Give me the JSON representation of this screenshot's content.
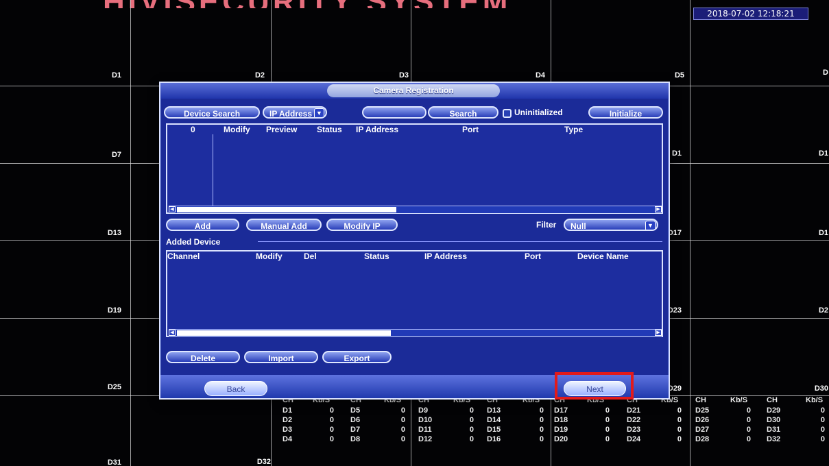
{
  "watermark": "HIVISECURITY SYSTEM",
  "timestamp": "2018-07-02 12:18:21",
  "grid_labels": [
    "D1",
    "D2",
    "D3",
    "D4",
    "D5",
    "D",
    "D7",
    "D1",
    "D13",
    "D1",
    "D17",
    "D1",
    "D19",
    "D2",
    "D23",
    "D25",
    "D29",
    "D30",
    "D31",
    "D32"
  ],
  "dialog": {
    "title": "Camera Registration",
    "top_buttons": {
      "device_search": "Device Search",
      "ip_address_select": "IP Address",
      "search": "Search",
      "uninitialized_label": "Uninitialized",
      "initialize": "Initialize"
    },
    "search_results": {
      "headers": [
        "0",
        "Modify",
        "Preview",
        "Status",
        "IP Address",
        "Port",
        "Type"
      ]
    },
    "actions": {
      "add": "Add",
      "manual_add": "Manual Add",
      "modify_ip": "Modify IP",
      "filter_label": "Filter",
      "filter_value": "Null"
    },
    "added_device": {
      "label": "Added Device",
      "headers": [
        "Channel",
        "Modify",
        "Del",
        "Status",
        "IP Address",
        "Port",
        "Device Name"
      ]
    },
    "bottom_actions": {
      "delete": "Delete",
      "import": "Import",
      "export": "Export"
    },
    "footer": {
      "back": "Back",
      "next": "Next"
    }
  },
  "bitrate": {
    "headers": [
      "CH",
      "Kb/S",
      "CH",
      "Kb/S",
      "CH",
      "Kb/S",
      "CH",
      "Kb/S",
      "CH",
      "Kb/S",
      "CH",
      "Kb/S",
      "CH",
      "Kb/S",
      "CH",
      "Kb/S"
    ],
    "rows": [
      [
        "D1",
        "0",
        "D5",
        "0",
        "D9",
        "0",
        "D13",
        "0",
        "D17",
        "0",
        "D21",
        "0",
        "D25",
        "0",
        "D29",
        "0"
      ],
      [
        "D2",
        "0",
        "D6",
        "0",
        "D10",
        "0",
        "D14",
        "0",
        "D18",
        "0",
        "D22",
        "0",
        "D26",
        "0",
        "D30",
        "0"
      ],
      [
        "D3",
        "0",
        "D7",
        "0",
        "D11",
        "0",
        "D15",
        "0",
        "D19",
        "0",
        "D23",
        "0",
        "D27",
        "0",
        "D31",
        "0"
      ],
      [
        "D4",
        "0",
        "D8",
        "0",
        "D12",
        "0",
        "D16",
        "0",
        "D20",
        "0",
        "D24",
        "0",
        "D28",
        "0",
        "D32",
        "0"
      ]
    ]
  },
  "colors": {
    "dialog_blue": "#1b2b98",
    "highlight_red": "#e21a1a"
  }
}
